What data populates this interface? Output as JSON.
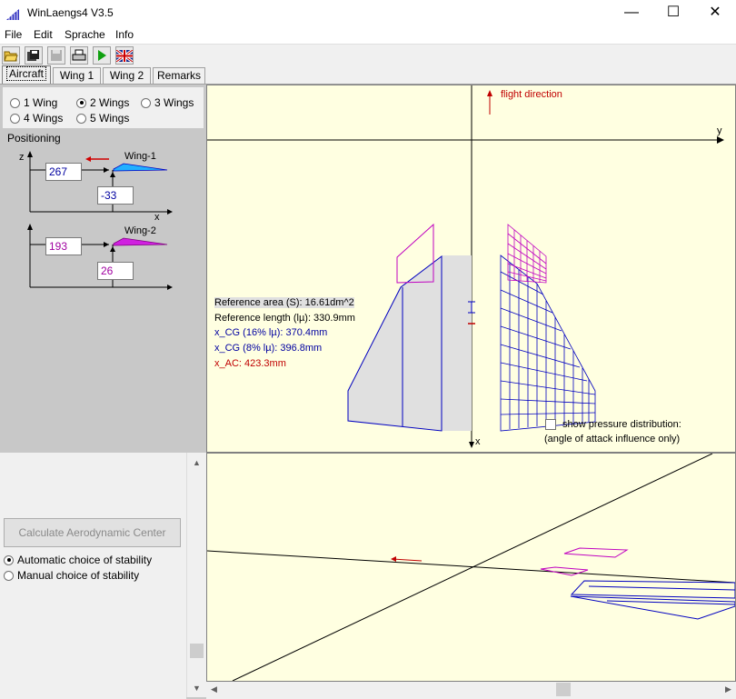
{
  "window": {
    "title": "WinLaengs4  V3.5",
    "minimize": "—",
    "maximize": "☐",
    "close": "✕"
  },
  "menu": [
    "File",
    "Edit",
    "Sprache",
    "Info"
  ],
  "toolbar": {
    "buttons": [
      "open-folder-icon",
      "save-all-icon",
      "save-disk-icon",
      "print-icon",
      "run-play-icon",
      "uk-flag-icon"
    ]
  },
  "tabs": [
    "Aircraft",
    "Wing 1",
    "Wing 2",
    "Remarks"
  ],
  "active_tab": "Aircraft",
  "wing_count": {
    "options": [
      "1 Wing",
      "2 Wings",
      "3 Wings",
      "4 Wings",
      "5 Wings"
    ],
    "selected": "2 Wings"
  },
  "positioning": {
    "title": "Positioning",
    "axis_z": "z",
    "axis_x": "x",
    "wing1": {
      "label": "Wing-1",
      "z_value": "267",
      "x_value": "-33"
    },
    "wing2": {
      "label": "Wing-2",
      "z_value": "193",
      "x_value": "26"
    }
  },
  "calc_button": "Calculate Aerodynamic Center",
  "stability": {
    "options": [
      "Automatic choice of stability",
      "Manual choice of stability"
    ],
    "selected": "Automatic choice of stability"
  },
  "top_view": {
    "flight_direction": "flight direction",
    "axis_y": "y",
    "axis_x": "x",
    "info": [
      {
        "text": "Reference area (S): 16.61dm^2",
        "color": "#000000"
      },
      {
        "text": "Reference length (lµ): 330.9mm",
        "color": "#000000"
      },
      {
        "text": "x_CG (16% lµ): 370.4mm",
        "color": "#0000a0"
      },
      {
        "text": "x_CG (8% lµ): 396.8mm",
        "color": "#0000a0"
      },
      {
        "text": "x_AC: 423.3mm",
        "color": "#c00000"
      }
    ],
    "pressure_checkbox": "show pressure distribution:",
    "pressure_note": "(angle of attack influence only)"
  },
  "colors": {
    "wing1": "#0000c0",
    "wing2": "#c000c0",
    "view_bg": "#ffffe1",
    "panel_bg": "#c8c8c8",
    "flight_arrow": "#c00000"
  }
}
